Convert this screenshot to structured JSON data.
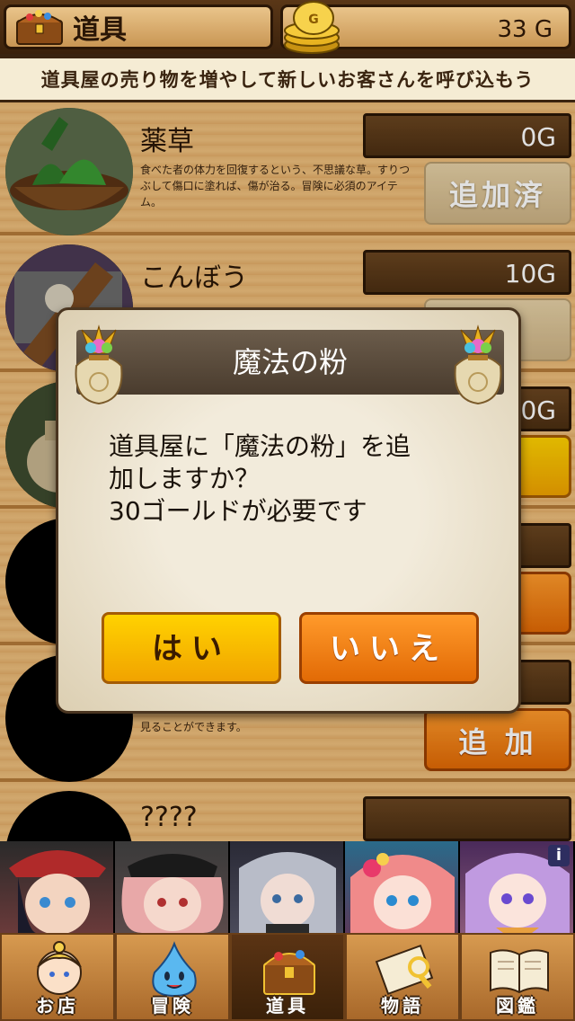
{
  "header": {
    "title": "道具",
    "gold": "33 G"
  },
  "banner": {
    "text": "道具屋の売り物を増やして新しいお客さんを呼び込もう"
  },
  "items": [
    {
      "name": "薬草",
      "price": "0G",
      "desc": "食べた者の体力を回復するという、不思議な草。すりつぶして傷口に塗れば、傷が治る。冒険に必須のアイテム。",
      "button": "追加済"
    },
    {
      "name": "こんぼう",
      "price": "10G",
      "desc": "",
      "button": "済"
    },
    {
      "name": "",
      "price": "0G",
      "desc": "",
      "button": "加"
    },
    {
      "name": "",
      "price": "",
      "desc": "",
      "button": "加"
    },
    {
      "name": "",
      "price": "",
      "desc": "見ることができます。",
      "button": "追 加"
    },
    {
      "name": "????",
      "price": "",
      "desc": "",
      "button": ""
    }
  ],
  "dialog": {
    "title": "魔法の粉",
    "message_line1": "道具屋に「魔法の粉」を追",
    "message_line2": "加しますか？",
    "message_line3": "30ゴールドが必要です",
    "yes": "はい",
    "no": "いいえ"
  },
  "characters": {
    "info_badge": "i"
  },
  "nav": [
    {
      "label": "お店",
      "icon": "shopkeeper-icon"
    },
    {
      "label": "冒険",
      "icon": "slime-icon"
    },
    {
      "label": "道具",
      "icon": "chest-icon"
    },
    {
      "label": "物語",
      "icon": "scroll-icon"
    },
    {
      "label": "図鑑",
      "icon": "book-icon"
    }
  ],
  "colors": {
    "wood_light": "#e8b774",
    "wood_dark": "#3a2410",
    "button_yellow": "#ffd200",
    "button_orange": "#ff9a2b"
  }
}
